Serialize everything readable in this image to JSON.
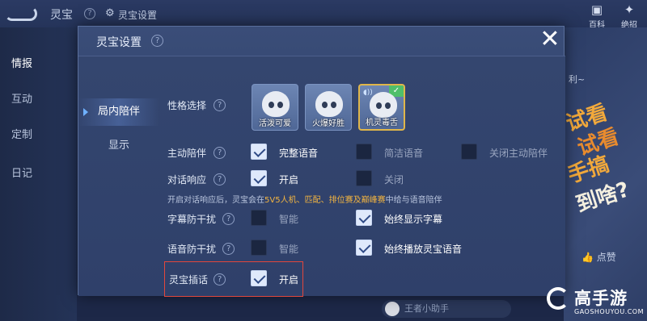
{
  "background": {
    "app_title": "灵宝",
    "help_glyph": "?",
    "settings_label": "灵宝设置",
    "right_icons": [
      {
        "label": "百科"
      },
      {
        "label": "绝招"
      }
    ],
    "sidebar": [
      "情报",
      "互动",
      "定制",
      "日记"
    ],
    "right_promo": [
      "试看",
      "试看",
      "手搞",
      "到啥?"
    ],
    "right_promo_top": "利~",
    "like_label": "点赞",
    "bottom_chip": "王者小助手"
  },
  "watermark": {
    "brand": "高手游",
    "url": "GAOSHOUYOU.COM"
  },
  "modal": {
    "title": "灵宝设置",
    "close_glyph": "✕",
    "tabs": [
      {
        "label": "局内陪伴",
        "active": true
      },
      {
        "label": "显示",
        "active": false
      }
    ],
    "personality": {
      "label": "性格选择",
      "options": [
        {
          "label": "活泼可爱",
          "selected": false
        },
        {
          "label": "火爆好胜",
          "selected": false
        },
        {
          "label": "机灵毒舌",
          "selected": true
        }
      ]
    },
    "active_companion": {
      "label": "主动陪伴",
      "options": [
        {
          "label": "完整语音",
          "checked": true
        },
        {
          "label": "简洁语音",
          "checked": false
        },
        {
          "label": "关闭主动陪伴",
          "checked": false
        }
      ]
    },
    "dialog_response": {
      "label": "对话响应",
      "options": [
        {
          "label": "开启",
          "checked": true
        },
        {
          "label": "关闭",
          "checked": false
        }
      ],
      "note_prefix": "开启对话响应后，灵宝会在",
      "note_highlight": "5V5人机、匹配、排位赛及巅峰赛",
      "note_suffix": "中给与语音陪伴"
    },
    "subtitle_anti_interference": {
      "label": "字幕防干扰",
      "options": [
        {
          "label": "智能",
          "checked": false
        },
        {
          "label": "始终显示字幕",
          "checked": true
        }
      ]
    },
    "voice_anti_interference": {
      "label": "语音防干扰",
      "options": [
        {
          "label": "智能",
          "checked": false
        },
        {
          "label": "始终播放灵宝语音",
          "checked": true
        }
      ]
    },
    "lingbao_interjection": {
      "label": "灵宝插话",
      "options": [
        {
          "label": "开启",
          "checked": true
        }
      ]
    }
  }
}
